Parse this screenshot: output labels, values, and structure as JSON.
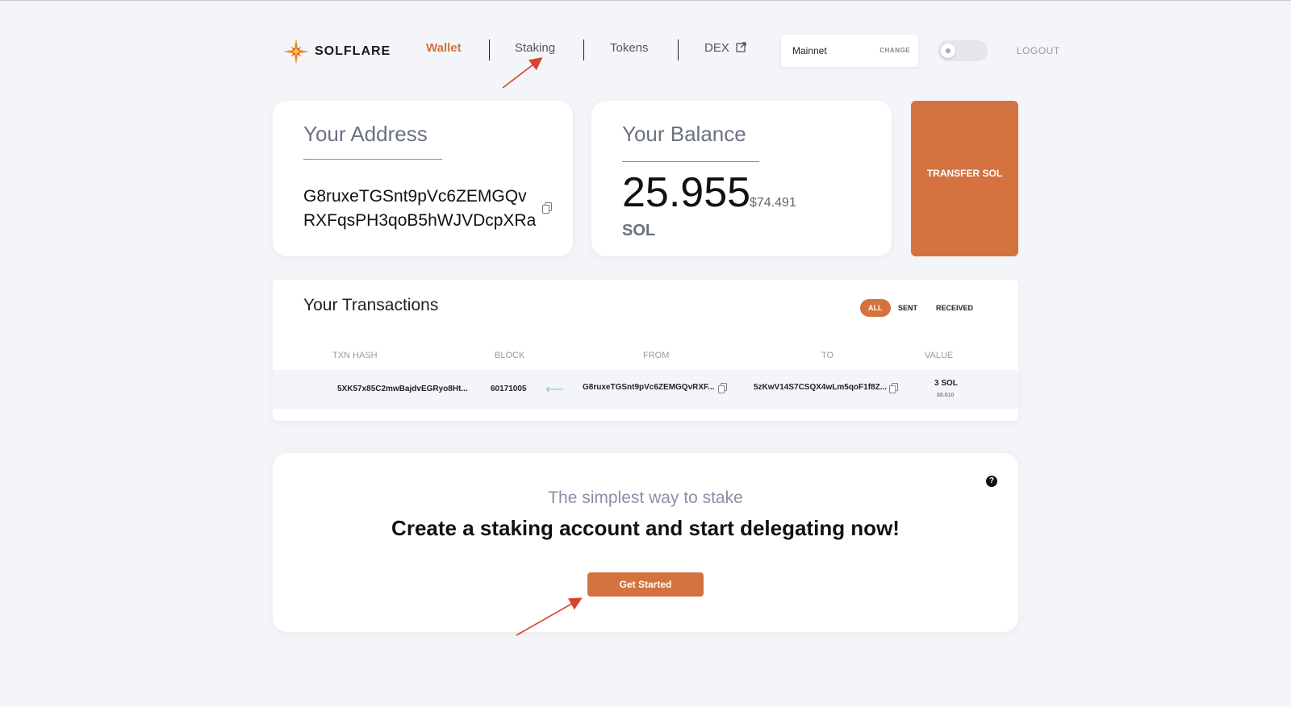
{
  "brand": {
    "name": "SOLFLARE"
  },
  "nav": {
    "wallet": "Wallet",
    "staking": "Staking",
    "tokens": "Tokens",
    "dex": "DEX"
  },
  "network": {
    "name": "Mainnet",
    "change": "CHANGE"
  },
  "logout": "LOGOUT",
  "address_card": {
    "title": "Your Address",
    "address": "G8ruxeTGSnt9pVc6ZEMGQvRXFqsPH3qoB5hWJVDcpXRa"
  },
  "balance_card": {
    "title": "Your Balance",
    "amount": "25.955",
    "usd": "$74.491",
    "unit": "SOL"
  },
  "transfer_button": "TRANSFER SOL",
  "transactions": {
    "title": "Your Transactions",
    "filters": [
      "ALL",
      "SENT",
      "RECEIVED"
    ],
    "active_filter": "ALL",
    "headers": [
      "TXN HASH",
      "BLOCK",
      "FROM",
      "TO",
      "VALUE"
    ],
    "rows": [
      {
        "hash": "5XK57x85C2mwBajdvEGRyo8Ht...",
        "block": "60171005",
        "from": "G8ruxeTGSnt9pVc6ZEMGQvRXF...",
        "to": "5zKwV14S7CSQX4wLm5qoF1f8Z...",
        "value": "3 SOL",
        "value_usd": "$8.610"
      }
    ]
  },
  "staking": {
    "subtitle": "The simplest way to stake",
    "headline": "Create a staking account and start delegating now!",
    "button": "Get Started"
  },
  "colors": {
    "accent": "#d4733f",
    "background": "#f4f5f9",
    "annotation_arrow": "#d9432b"
  }
}
